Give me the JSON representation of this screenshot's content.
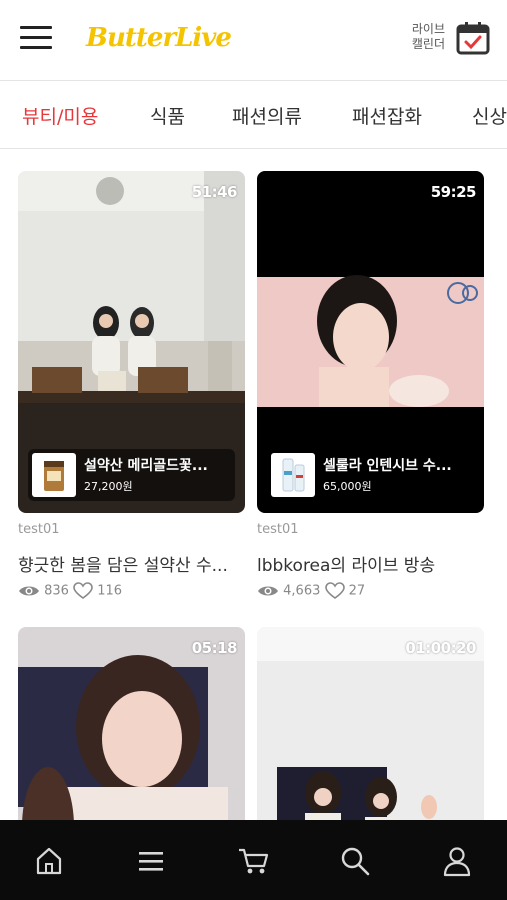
{
  "header": {
    "logo": "ButterLive",
    "calendar_label_line1": "라이브",
    "calendar_label_line2": "캘린더"
  },
  "tabs": [
    {
      "label": "뷰티/미용",
      "active": true
    },
    {
      "label": "식품",
      "active": false
    },
    {
      "label": "패션의류",
      "active": false
    },
    {
      "label": "패션잡화",
      "active": false
    },
    {
      "label": "신상",
      "active": false
    }
  ],
  "cards": [
    {
      "duration": "51:46",
      "product_name": "설약산 메리골드꽃...",
      "product_price": "27,200원",
      "seller": "test01",
      "title": "향긋한 봄을 담은 설약산 수...",
      "views": "836",
      "likes": "116"
    },
    {
      "duration": "59:25",
      "product_name": "셀룰라 인텐시브 수...",
      "product_price": "65,000원",
      "seller": "test01",
      "title": "lbbkorea의 라이브 방송",
      "views": "4,663",
      "likes": "27"
    },
    {
      "duration": "05:18"
    },
    {
      "duration": "01:00:20"
    }
  ],
  "bottom_nav": [
    "home-icon",
    "menu-icon",
    "cart-icon",
    "search-icon",
    "user-icon"
  ],
  "colors": {
    "accent": "#e6373a",
    "logo": "#f5c400",
    "nav_bg": "#0b0b0b"
  }
}
